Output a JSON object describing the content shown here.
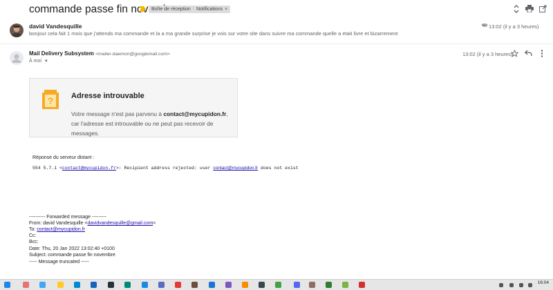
{
  "thread": {
    "subject": "commande passe fin novembre",
    "labels": [
      {
        "name": "Boîte de réception",
        "remove": "×"
      },
      {
        "name": "Notifications",
        "remove": "×"
      }
    ]
  },
  "message1": {
    "sender": "david Vandesquille",
    "snippet": "bonjour cela fait 1 mois que j'attends ma commande et la a ma grande surprise je vois sur votre site dans suivre ma commande quelle a etait livre et bizarrement",
    "time": "13:02 (il y a 3 heures)"
  },
  "message2": {
    "sender_name": "Mail Delivery Subsystem",
    "sender_email": "<mailer-daemon@googlemail.com>",
    "to": "À moi",
    "time": "13:02 (il y a 3 heures)",
    "bounce": {
      "title": "Adresse introuvable",
      "text_before": "Votre message n'est pas parvenu à ",
      "address": "contact@mycupidon.fr",
      "text_after": ", car l'adresse est introuvable ou ne peut pas recevoir de messages."
    },
    "server": {
      "title": "Réponse du serveur distant :",
      "code": "554 5.7.1 <",
      "link1": "contact@mycupidon.fr",
      "middle": ">: Recipient address rejected: user ",
      "link2": "contact@mycupidon.fr",
      "end": " does not exist"
    },
    "forwarded": {
      "header": "---------- Forwarded message ---------",
      "from_label": "From: david Vandesquille <",
      "from_email": "davidvandesquille@gmail.com",
      "from_end": ">",
      "to_label": "To: ",
      "to_email": "contact@mycupidon.fr",
      "cc": "Cc:",
      "bcc": "Bcc:",
      "date": "Date: Thu, 20 Jan 2022 13:02:40 +0100",
      "subject": "Subject: commande passe fin novembre",
      "truncated": "----- Message truncated -----"
    }
  },
  "taskbar": {
    "clock_time": "16:04"
  },
  "colors": {
    "importance": "#f4b400",
    "warning": "#f9a825",
    "link": "#1a0dab"
  }
}
